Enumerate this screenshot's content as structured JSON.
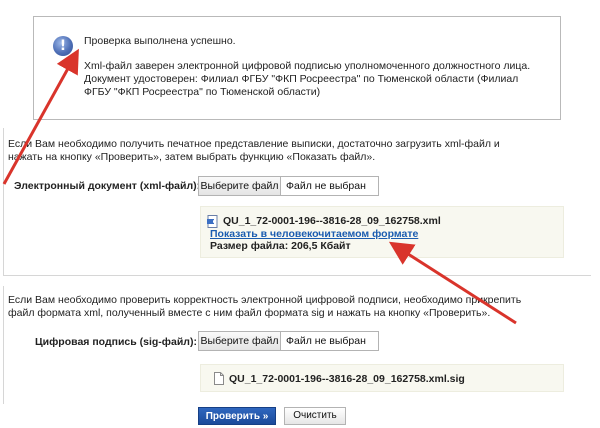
{
  "verification": {
    "status": "Проверка выполнена успешно.",
    "detail": "Xml-файл заверен электронной цифровой подписью уполномоченного должностного лица. Документ удостоверен: Филиал ФГБУ \"ФКП Росреестра\" по Тюменской области (Филиал ФГБУ \"ФКП Росреестра\" по Тюменской области)"
  },
  "xml_section": {
    "hint": "Если Вам необходимо получить печатное представление выписки, достаточно загрузить xml-файл и нажать на кнопку «Проверить», затем выбрать функцию «Показать файл».",
    "label": "Электронный документ (xml-файл):",
    "choose_button": "Выберите файл",
    "file_status": "Файл не выбран",
    "result": {
      "file_name": "QU_1_72-0001-196--3816-28_09_162758.xml",
      "link": "Показать в человекочитаемом формате",
      "size": "Размер файла: 206,5 Кбайт"
    }
  },
  "sig_section": {
    "hint": "Если Вам необходимо проверить корректность электронной цифровой подписи, необходимо прикрепить файл формата xml, полученный вместе с ним файл формата sig и нажать на кнопку «Проверить».",
    "label": "Цифровая подпись (sig-файл):",
    "choose_button": "Выберите файл",
    "file_status": "Файл не выбран",
    "file_name": "QU_1_72-0001-196--3816-28_09_162758.xml.sig"
  },
  "actions": {
    "check": "Проверить »",
    "clear": "Очистить"
  },
  "colors": {
    "arrow": "#d9342b",
    "link": "#1a5cb0",
    "primary": "#1f55a8"
  },
  "icons": [
    "info-icon",
    "xml-document-icon",
    "sig-document-icon",
    "annotation-arrow"
  ]
}
